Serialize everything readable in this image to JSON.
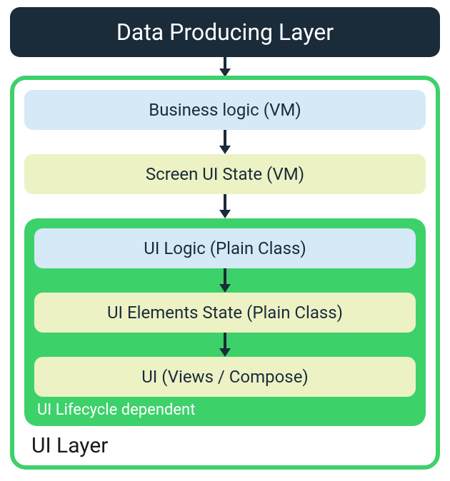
{
  "diagram": {
    "top_layer": "Data Producing Layer",
    "ui_layer_label": "UI Layer",
    "inner_label": "UI Lifecycle dependent",
    "boxes": {
      "business_logic": "Business logic (VM)",
      "screen_ui_state": "Screen UI State (VM)",
      "ui_logic": "UI Logic (Plain Class)",
      "ui_elements_state": "UI Elements State (Plain Class)",
      "ui_views": "UI (Views / Compose)"
    },
    "colors": {
      "dark": "#1a2b3a",
      "green": "#3dd16a",
      "blue": "#d6e9f7",
      "yellow": "#edf2c5"
    }
  }
}
